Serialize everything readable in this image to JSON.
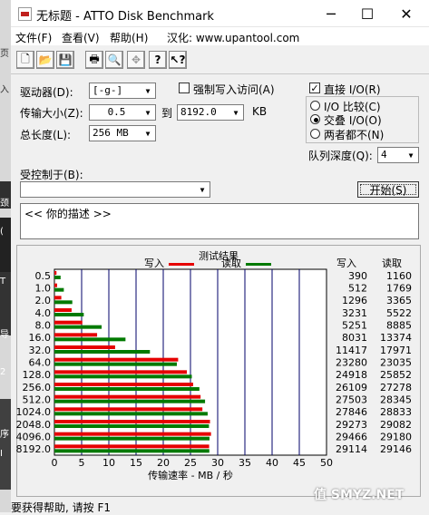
{
  "window": {
    "title": "无标题 - ATTO Disk Benchmark",
    "minimize": "─",
    "maximize": "☐",
    "close": "✕"
  },
  "menu": [
    "文件(F)",
    "查看(V)",
    "帮助(H)",
    "汉化: www.upantool.com"
  ],
  "toolbar_icons": [
    "new-icon",
    "open-icon",
    "save-icon",
    "print-icon",
    "print-preview-icon",
    "move-icon",
    "help-icon",
    "context-help-icon"
  ],
  "form": {
    "drive_label": "驱动器(D):",
    "drive_value": "[-g-]",
    "force_write_label": "强制写入访问(A)",
    "force_write_checked": false,
    "direct_io_label": "直接 I/O(R)",
    "direct_io_checked": true,
    "transfer_label": "传输大小(Z):",
    "transfer_from": "0.5",
    "to_label": "到",
    "transfer_to": "8192.0",
    "transfer_unit": "KB",
    "total_label": "总长度(L):",
    "total_value": "256 MB",
    "io_compare_label": "I/O 比较(C)",
    "overlap_io_label": "交叠 I/O(O)",
    "neither_label": "两者都不(N)",
    "queue_label": "队列深度(Q):",
    "queue_value": "4",
    "controlled_label": "受控制于(B):",
    "controlled_value": "",
    "start_button": "开始(S)",
    "description": "<<   你的描述   >>"
  },
  "results": {
    "title": "测试结果",
    "legend_write": "写入",
    "legend_read": "读取",
    "col_write": "写入",
    "col_read": "读取",
    "xlabel": "传输速率 - MB / 秒",
    "colors": {
      "write": "#e60000",
      "read": "#007a00",
      "grid": "#00006a"
    }
  },
  "chart_data": {
    "type": "bar",
    "orientation": "horizontal",
    "categories": [
      "0.5",
      "1.0",
      "2.0",
      "4.0",
      "8.0",
      "16.0",
      "32.0",
      "64.0",
      "128.0",
      "256.0",
      "512.0",
      "1024.0",
      "2048.0",
      "4096.0",
      "8192.0"
    ],
    "series": [
      {
        "name": "写入",
        "values": [
          390,
          512,
          1296,
          3231,
          5251,
          8031,
          11417,
          23280,
          24918,
          26109,
          27503,
          27846,
          29273,
          29466,
          29114
        ]
      },
      {
        "name": "读取",
        "values": [
          1160,
          1769,
          3365,
          5522,
          8885,
          13374,
          17971,
          23035,
          25852,
          27278,
          28345,
          28833,
          29082,
          29180,
          29146
        ]
      }
    ],
    "xlabel": "传输速率 - MB / 秒",
    "xlim": [
      0,
      50
    ],
    "xticks": [
      "0",
      "5",
      "10",
      "15",
      "20",
      "25",
      "30",
      "35",
      "40",
      "45",
      "50"
    ],
    "units_note": "",
    "grid": true,
    "legend": "top"
  },
  "status": "要获得帮助, 请按 F1",
  "desktop_strip": [
    "页",
    "入",
    "颈",
    "(",
    "T",
    "导",
    "2",
    "序",
    "I"
  ],
  "watermark": "SMYZ.NET"
}
